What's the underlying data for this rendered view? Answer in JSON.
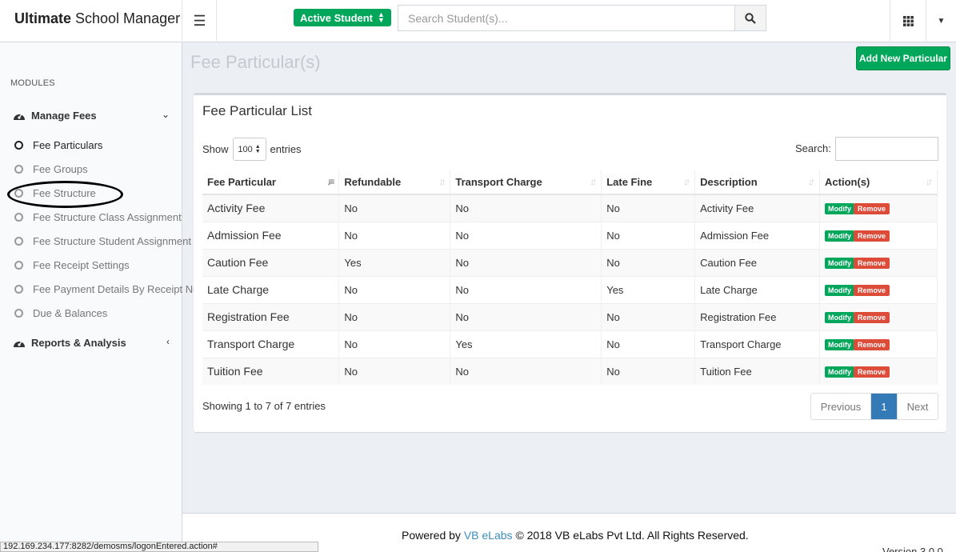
{
  "app": {
    "title_bold": "Ultimate",
    "title_rest": " School Manager"
  },
  "header": {
    "status_button": "Active Student",
    "search_placeholder": "Search Student(s)..."
  },
  "sidebar": {
    "modules_label": "MODULES",
    "sections": [
      {
        "label": "Manage Fees",
        "icon": "dashboard-icon"
      },
      {
        "label": "Reports & Analysis",
        "icon": "dashboard-icon"
      }
    ],
    "items": [
      {
        "label": "Fee Particulars",
        "active": true
      },
      {
        "label": "Fee Groups"
      },
      {
        "label": "Fee Structure"
      },
      {
        "label": "Fee Structure Class Assignment"
      },
      {
        "label": "Fee Structure Student Assignment"
      },
      {
        "label": "Fee Receipt Settings"
      },
      {
        "label": "Fee Payment Details By Receipt No."
      },
      {
        "label": "Due & Balances"
      }
    ]
  },
  "page": {
    "title": "Fee Particular(s)",
    "add_button": "Add New Particular"
  },
  "table_box": {
    "title": "Fee Particular List",
    "show_label": "Show",
    "entries_value": "100",
    "entries_label": "entries",
    "search_label": "Search:",
    "columns": [
      "Fee Particular",
      "Refundable",
      "Transport Charge",
      "Late Fine",
      "Description",
      "Action(s)"
    ],
    "rows": [
      [
        "Activity Fee",
        "No",
        "No",
        "No",
        "Activity Fee"
      ],
      [
        "Admission Fee",
        "No",
        "No",
        "No",
        "Admission Fee"
      ],
      [
        "Caution Fee",
        "Yes",
        "No",
        "No",
        "Caution Fee"
      ],
      [
        "Late Charge",
        "No",
        "No",
        "Yes",
        "Late Charge"
      ],
      [
        "Registration Fee",
        "No",
        "No",
        "No",
        "Registration Fee"
      ],
      [
        "Transport Charge",
        "No",
        "Yes",
        "No",
        "Transport Charge"
      ],
      [
        "Tuition Fee",
        "No",
        "No",
        "No",
        "Tuition Fee"
      ]
    ],
    "modify_label": "Modify",
    "remove_label": "Remove",
    "info": "Showing 1 to 7 of 7 entries",
    "pager": {
      "previous": "Previous",
      "page": "1",
      "next": "Next"
    }
  },
  "footer": {
    "powered_by": "Powered by",
    "brand": "VB eLabs",
    "copyright": "© 2018 VB eLabs Pvt Ltd. All Rights Reserved.",
    "version": "Version 3.0.0"
  },
  "status_url": "192.169.234.177:8282/demosms/logonEntered.action#",
  "colors": {
    "accent_green": "#00a65a",
    "danger_red": "#dd4b39",
    "primary_blue": "#337ab7"
  }
}
